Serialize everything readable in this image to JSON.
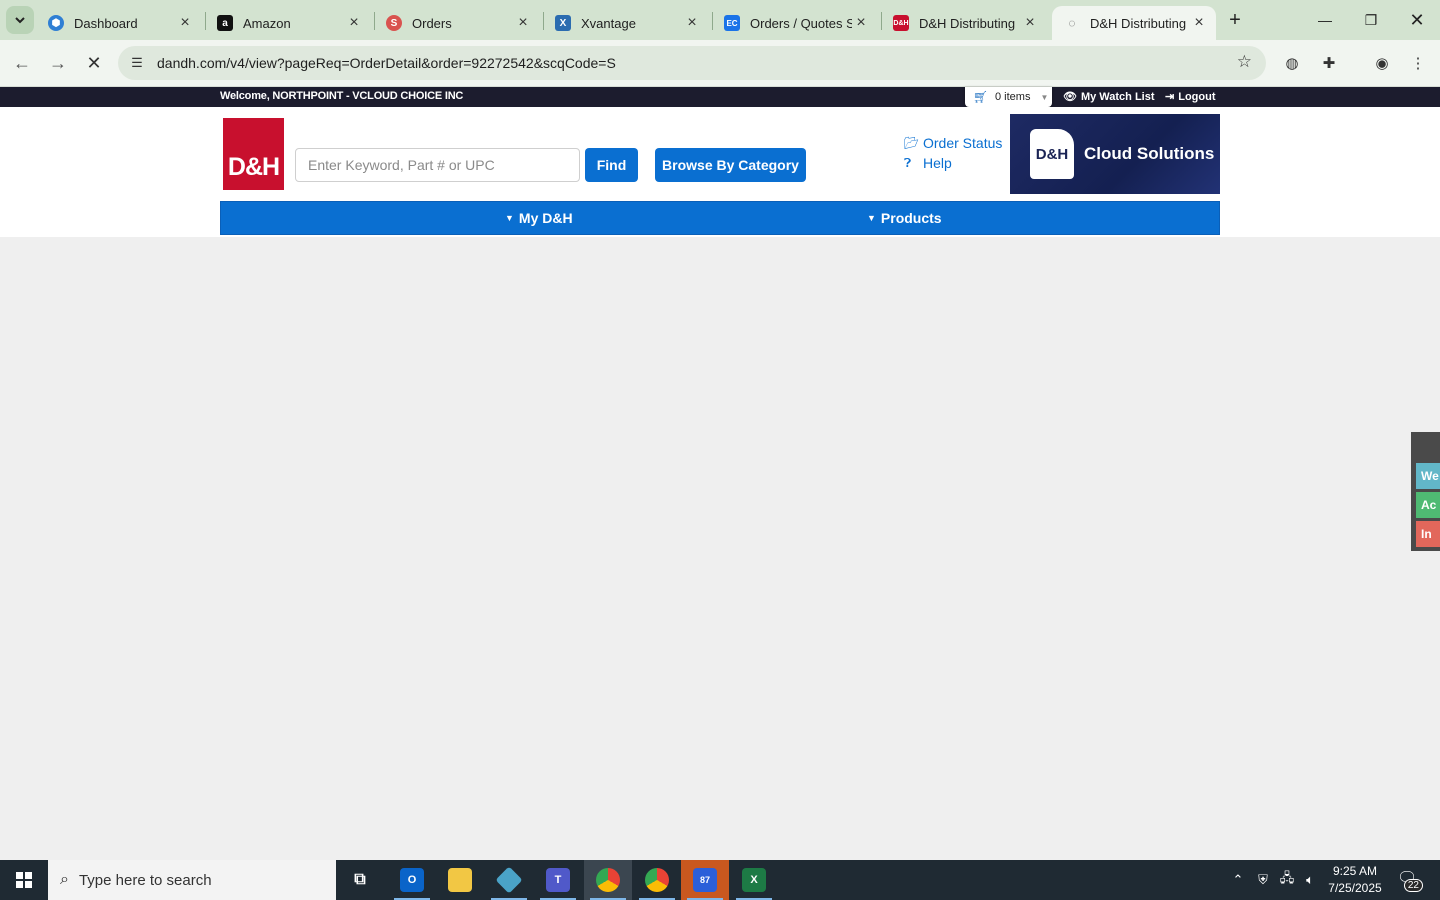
{
  "browser": {
    "tabs": [
      {
        "title": "Dashboard",
        "favicon": "hexagon-icon",
        "color": "#2f7fd4"
      },
      {
        "title": "Amazon",
        "favicon": "amazon-icon",
        "color": "#111111"
      },
      {
        "title": "Orders",
        "favicon": "s-icon",
        "color": "#d9534f"
      },
      {
        "title": "Xvantage",
        "favicon": "x-icon",
        "color": "#2b6cb0"
      },
      {
        "title": "Orders / Quotes S",
        "favicon": "ec-icon",
        "color": "#1a73e8"
      },
      {
        "title": "D&H Distributing",
        "favicon": "dh-icon",
        "color": "#c8102e"
      },
      {
        "title": "D&H Distributing",
        "favicon": "loading-icon",
        "color": "#555555"
      }
    ],
    "active_tab_index": 6,
    "url": "dandh.com/v4/view?pageReq=OrderDetail&order=92272542&scqCode=S"
  },
  "site": {
    "welcome": "Welcome, NORTHPOINT - VCLOUD CHOICE INC",
    "cart_label": "0 items",
    "watch_list": "My Watch List",
    "logout": "Logout",
    "logo_text": "D&H",
    "search_placeholder": "Enter Keyword, Part # or UPC",
    "find_label": "Find",
    "browse_label": "Browse By Category",
    "order_status": "Order Status",
    "help": "Help",
    "cloud_logo_text": "D&H",
    "cloud_label": "Cloud Solutions",
    "nav": [
      "My D&H",
      "Products"
    ],
    "side_widget": [
      {
        "label": "We",
        "color": "#62b7c8"
      },
      {
        "label": "Ac",
        "color": "#4fba73"
      },
      {
        "label": "In",
        "color": "#e2675b"
      }
    ]
  },
  "taskbar": {
    "search_placeholder": "Type here to search",
    "apps": [
      {
        "name": "task-view-icon",
        "label": ""
      },
      {
        "name": "outlook-icon",
        "label": "O"
      },
      {
        "name": "file-explorer-icon",
        "label": ""
      },
      {
        "name": "app-diamond-icon",
        "label": ""
      },
      {
        "name": "teams-icon",
        "label": "T"
      },
      {
        "name": "chrome-icon",
        "label": ""
      },
      {
        "name": "chrome-profile-icon",
        "label": ""
      },
      {
        "name": "zoho-icon",
        "label": "87"
      },
      {
        "name": "excel-icon",
        "label": "X"
      }
    ],
    "time": "9:25 AM",
    "date": "7/25/2025",
    "notifications": "22"
  },
  "colors": {
    "brand_red": "#c8102e",
    "brand_blue": "#0a6fd1",
    "strip_dark": "#1c1c2e"
  }
}
